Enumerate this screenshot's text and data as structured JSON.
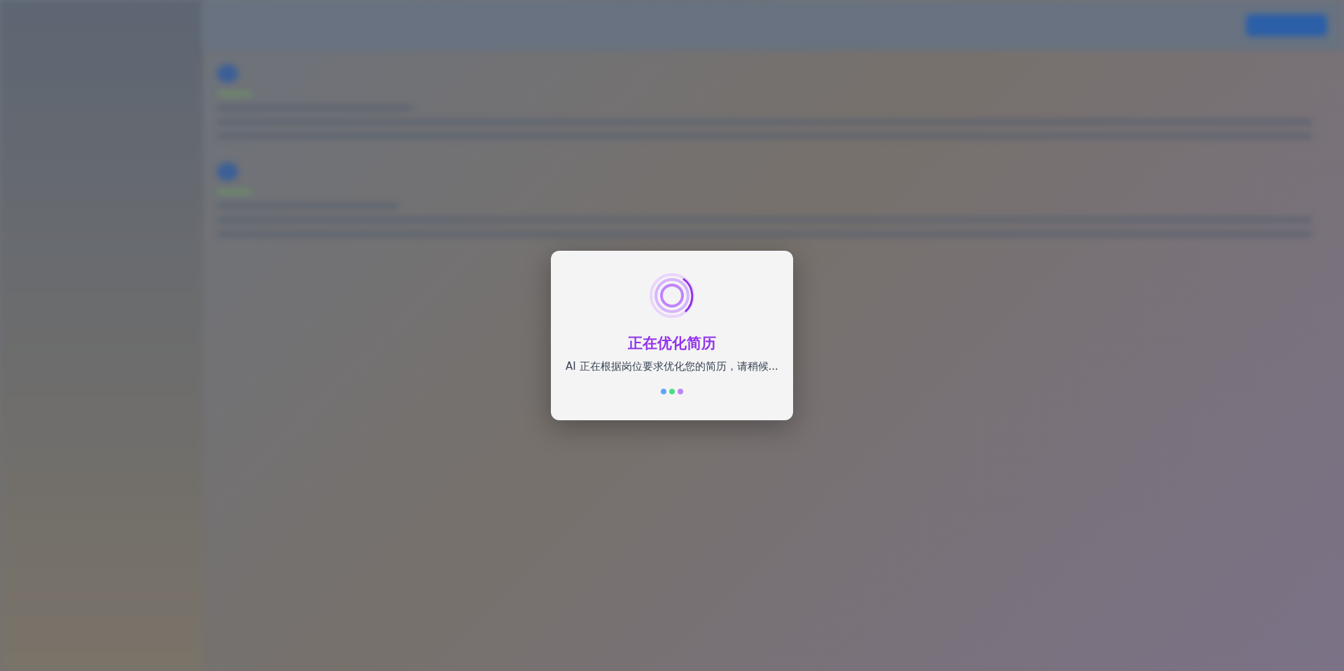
{
  "dialog": {
    "title": "正在优化简历",
    "message": "AI 正在根据岗位要求优化您的简历，请稍候...",
    "dots": [
      {
        "color": "#60a5fa"
      },
      {
        "color": "#4ade80"
      },
      {
        "color": "#c084fc"
      }
    ]
  }
}
